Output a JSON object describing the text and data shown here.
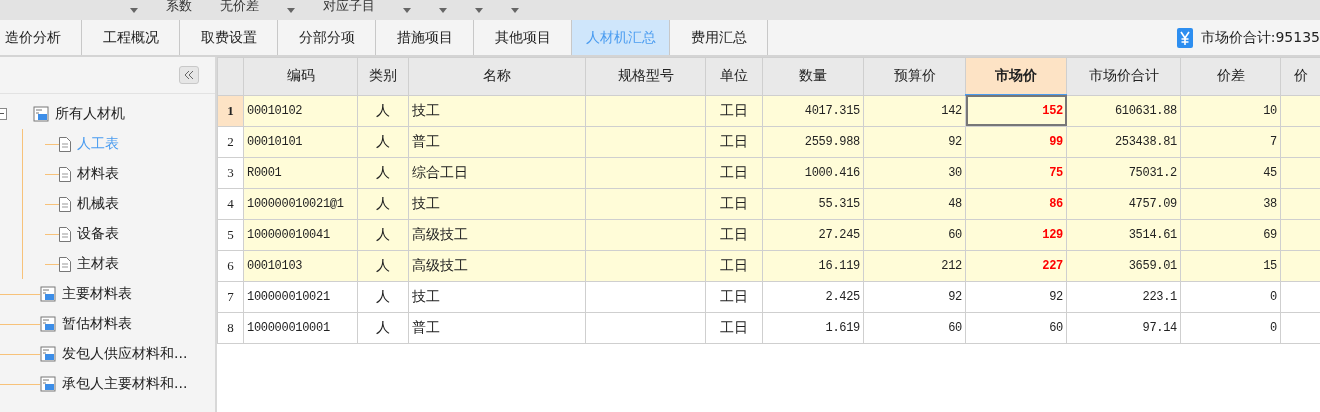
{
  "toolbar": [
    {
      "kind": "caret"
    },
    {
      "kind": "label",
      "label": "系数"
    },
    {
      "kind": "label",
      "label": "无价差"
    },
    {
      "kind": "caret"
    },
    {
      "kind": "label",
      "label": "对应子目"
    },
    {
      "kind": "caret"
    },
    {
      "kind": "caret"
    },
    {
      "kind": "caret"
    },
    {
      "kind": "caret"
    }
  ],
  "tabs": [
    {
      "label": "造价分析",
      "selected": false
    },
    {
      "label": "工程概况",
      "selected": false
    },
    {
      "label": "取费设置",
      "selected": false
    },
    {
      "label": "分部分项",
      "selected": false
    },
    {
      "label": "措施项目",
      "selected": false
    },
    {
      "label": "其他项目",
      "selected": false
    },
    {
      "label": "人材机汇总",
      "selected": true
    },
    {
      "label": "费用汇总",
      "selected": false
    }
  ],
  "summary": {
    "label": "市场价合计:95135"
  },
  "sidebar": {
    "tree": [
      {
        "label": "所有人材机",
        "kind": "group",
        "selected": false,
        "expanded": true,
        "children": [
          {
            "label": "人工表",
            "kind": "leaf",
            "selected": true
          },
          {
            "label": "材料表",
            "kind": "leaf",
            "selected": false
          },
          {
            "label": "机械表",
            "kind": "leaf",
            "selected": false
          },
          {
            "label": "设备表",
            "kind": "leaf",
            "selected": false
          },
          {
            "label": "主材表",
            "kind": "leaf",
            "selected": false
          }
        ]
      },
      {
        "label": "主要材料表",
        "kind": "group",
        "selected": false,
        "expanded": false
      },
      {
        "label": "暂估材料表",
        "kind": "group",
        "selected": false,
        "expanded": false
      },
      {
        "label": "发包人供应材料和...",
        "kind": "group",
        "selected": false,
        "expanded": false
      },
      {
        "label": "承包人主要材料和...",
        "kind": "group",
        "selected": false,
        "expanded": false
      }
    ]
  },
  "table": {
    "columns": [
      {
        "label": "编码",
        "selected": false
      },
      {
        "label": "类别",
        "selected": false
      },
      {
        "label": "名称",
        "selected": false
      },
      {
        "label": "规格型号",
        "selected": false
      },
      {
        "label": "单位",
        "selected": false
      },
      {
        "label": "数量",
        "selected": false
      },
      {
        "label": "预算价",
        "selected": false
      },
      {
        "label": "市场价",
        "selected": true
      },
      {
        "label": "市场价合计",
        "selected": false
      },
      {
        "label": "价差",
        "selected": false
      },
      {
        "label": "价",
        "selected": false
      }
    ],
    "rows": [
      {
        "no": "1",
        "selected": true,
        "highlighted": true,
        "price_changed": true,
        "cells": [
          "00010102",
          "人",
          "技工",
          "",
          "工日",
          "4017.315",
          "142",
          "152",
          "610631.88",
          "10",
          ""
        ]
      },
      {
        "no": "2",
        "selected": false,
        "highlighted": true,
        "price_changed": true,
        "cells": [
          "00010101",
          "人",
          "普工",
          "",
          "工日",
          "2559.988",
          "92",
          "99",
          "253438.81",
          "7",
          ""
        ]
      },
      {
        "no": "3",
        "selected": false,
        "highlighted": true,
        "price_changed": true,
        "cells": [
          "R0001",
          "人",
          "综合工日",
          "",
          "工日",
          "1000.416",
          "30",
          "75",
          "75031.2",
          "45",
          ""
        ]
      },
      {
        "no": "4",
        "selected": false,
        "highlighted": true,
        "price_changed": true,
        "cells": [
          "100000010021@1",
          "人",
          "技工",
          "",
          "工日",
          "55.315",
          "48",
          "86",
          "4757.09",
          "38",
          ""
        ]
      },
      {
        "no": "5",
        "selected": false,
        "highlighted": true,
        "price_changed": true,
        "cells": [
          "100000010041",
          "人",
          "高级技工",
          "",
          "工日",
          "27.245",
          "60",
          "129",
          "3514.61",
          "69",
          ""
        ]
      },
      {
        "no": "6",
        "selected": false,
        "highlighted": true,
        "price_changed": true,
        "cells": [
          "00010103",
          "人",
          "高级技工",
          "",
          "工日",
          "16.119",
          "212",
          "227",
          "3659.01",
          "15",
          ""
        ]
      },
      {
        "no": "7",
        "selected": false,
        "highlighted": false,
        "price_changed": false,
        "cells": [
          "100000010021",
          "人",
          "技工",
          "",
          "工日",
          "2.425",
          "92",
          "92",
          "223.1",
          "0",
          ""
        ]
      },
      {
        "no": "8",
        "selected": false,
        "highlighted": false,
        "price_changed": false,
        "cells": [
          "100000010001",
          "人",
          "普工",
          "",
          "工日",
          "1.619",
          "60",
          "60",
          "97.14",
          "0",
          ""
        ]
      }
    ]
  }
}
